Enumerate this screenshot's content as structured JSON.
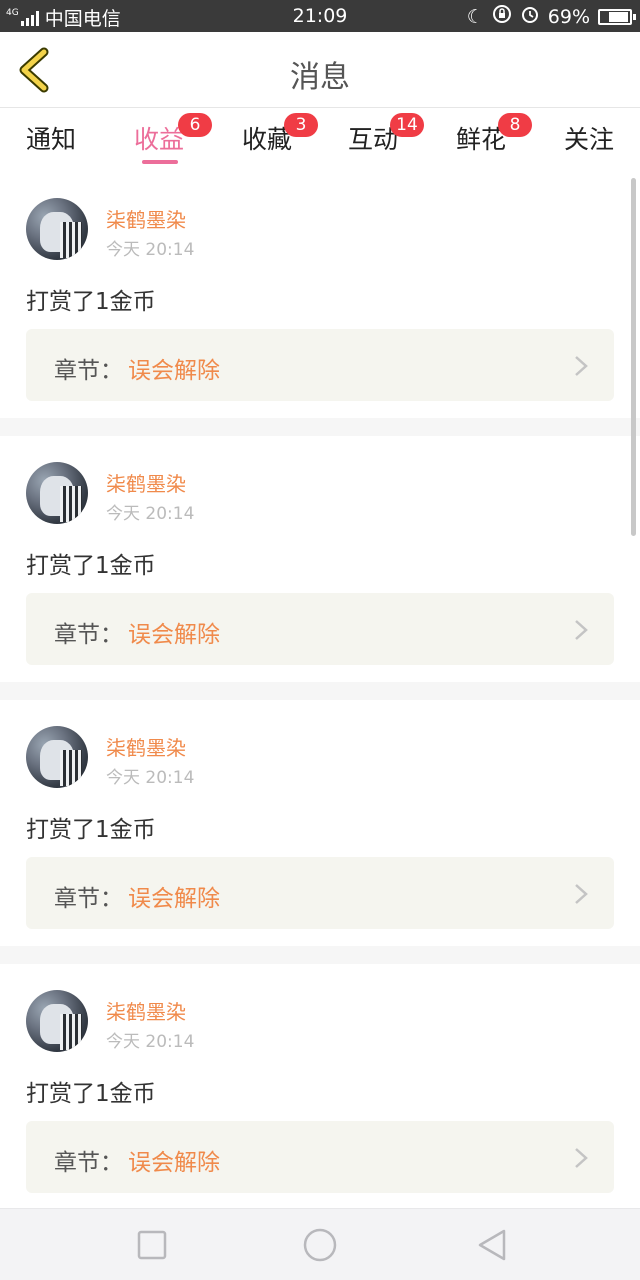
{
  "status_bar": {
    "network": "4G",
    "carrier": "中国电信",
    "time": "21:09",
    "battery_percent": "69%",
    "battery_level": 0.69,
    "icons": [
      "moon-icon",
      "rotation-lock-icon",
      "alarm-icon",
      "battery-icon"
    ]
  },
  "header": {
    "back_icon": "chevron-left-icon",
    "title": "消息"
  },
  "tabs": [
    {
      "label": "通知",
      "badge": ""
    },
    {
      "label": "收益",
      "badge": "6",
      "active": true
    },
    {
      "label": "收藏",
      "badge": "3"
    },
    {
      "label": "互动",
      "badge": "14"
    },
    {
      "label": "鲜花",
      "badge": "8"
    },
    {
      "label": "关注",
      "badge": ""
    }
  ],
  "messages": [
    {
      "username": "柒鹤墨染",
      "time": "今天 20:14",
      "action": "打赏了1金币",
      "chapter_label": "章节：",
      "chapter_name": "误会解除"
    },
    {
      "username": "柒鹤墨染",
      "time": "今天 20:14",
      "action": "打赏了1金币",
      "chapter_label": "章节：",
      "chapter_name": "误会解除"
    },
    {
      "username": "柒鹤墨染",
      "time": "今天 20:14",
      "action": "打赏了1金币",
      "chapter_label": "章节：",
      "chapter_name": "误会解除"
    },
    {
      "username": "柒鹤墨染",
      "time": "今天 20:14",
      "action": "打赏了1金币",
      "chapter_label": "章节：",
      "chapter_name": "误会解除"
    }
  ],
  "navbar": {
    "icons": [
      "square-icon",
      "circle-icon",
      "triangle-back-icon"
    ]
  },
  "colors": {
    "accent": "#ec6e9a",
    "badge": "#f03c45",
    "highlight": "#f08a4b",
    "status_bar_bg": "#3a3a3a"
  }
}
